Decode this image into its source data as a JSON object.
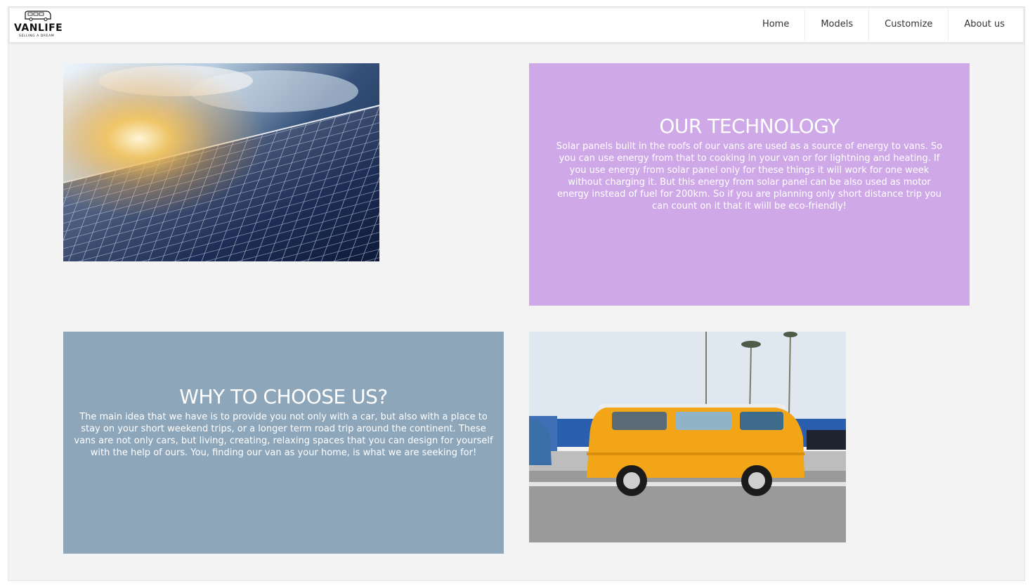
{
  "brand": {
    "name": "VANLIFE",
    "tagline": "SELLING A DREAM",
    "logo_icon": "van-icon"
  },
  "nav": {
    "items": [
      {
        "label": "Home"
      },
      {
        "label": "Models"
      },
      {
        "label": "Customize"
      },
      {
        "label": "About us"
      }
    ]
  },
  "sections": {
    "technology": {
      "title": "OUR TECHNOLOGY",
      "body": "Solar panels built in the roofs of our vans are used as a source of energy to vans. So you can use energy from that to cooking in your van or for lightning and heating. If you use energy from solar panel only for these things it will work for one week without charging it. But this energy from solar panel can be also used as motor energy instead of fuel for 200km. So if you are planning only short distance trip you can count on it that it wiill be eco-friendly!",
      "bg_color": "#cfa8e8"
    },
    "why": {
      "title": "WHY TO CHOOSE US?",
      "body": "The main idea that we have is to provide you not only with a car, but also with a place to stay on your short weekend trips, or a longer term road trip around the continent. These vans are not only cars, but living, creating, relaxing spaces that you can design for yourself with the help of ours. You, finding our van as your home, is what we are seeking for!",
      "bg_color": "#8ea6ba"
    }
  },
  "images": {
    "solar": "solar-panels-photo",
    "van": "yellow-van-photo"
  }
}
